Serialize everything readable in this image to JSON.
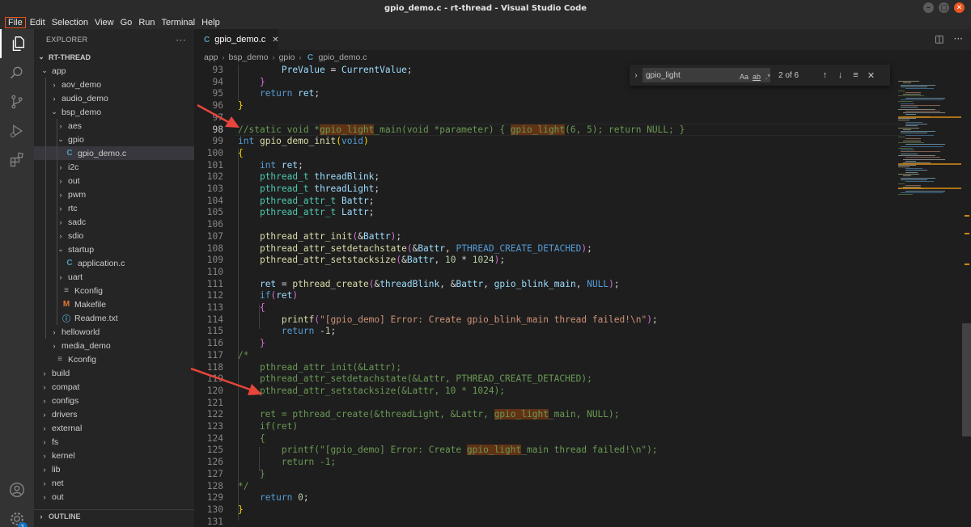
{
  "window": {
    "title": "gpio_demo.c - rt-thread - Visual Studio Code"
  },
  "menu": [
    "File",
    "Edit",
    "Selection",
    "View",
    "Go",
    "Run",
    "Terminal",
    "Help"
  ],
  "activity": {
    "account_badge": "1"
  },
  "explorer": {
    "header": "EXPLORER",
    "more": "···",
    "root": "RT-THREAD",
    "outline": "OUTLINE",
    "tree": [
      {
        "label": "app",
        "depth": 1,
        "kind": "folder-open"
      },
      {
        "label": "aov_demo",
        "depth": 2,
        "kind": "folder"
      },
      {
        "label": "audio_demo",
        "depth": 2,
        "kind": "folder"
      },
      {
        "label": "bsp_demo",
        "depth": 2,
        "kind": "folder-open"
      },
      {
        "label": "aes",
        "depth": 3,
        "kind": "folder"
      },
      {
        "label": "gpio",
        "depth": 3,
        "kind": "folder-open"
      },
      {
        "label": "gpio_demo.c",
        "depth": 4,
        "kind": "c",
        "selected": true
      },
      {
        "label": "i2c",
        "depth": 3,
        "kind": "folder"
      },
      {
        "label": "out",
        "depth": 3,
        "kind": "folder"
      },
      {
        "label": "pwm",
        "depth": 3,
        "kind": "folder"
      },
      {
        "label": "rtc",
        "depth": 3,
        "kind": "folder"
      },
      {
        "label": "sadc",
        "depth": 3,
        "kind": "folder"
      },
      {
        "label": "sdio",
        "depth": 3,
        "kind": "folder"
      },
      {
        "label": "startup",
        "depth": 3,
        "kind": "folder-open"
      },
      {
        "label": "application.c",
        "depth": 4,
        "kind": "c"
      },
      {
        "label": "uart",
        "depth": 3,
        "kind": "folder"
      },
      {
        "label": "Kconfig",
        "depth": 3,
        "kind": "list"
      },
      {
        "label": "Makefile",
        "depth": 3,
        "kind": "m"
      },
      {
        "label": "Readme.txt",
        "depth": 3,
        "kind": "info"
      },
      {
        "label": "helloworld",
        "depth": 2,
        "kind": "folder"
      },
      {
        "label": "media_demo",
        "depth": 2,
        "kind": "folder"
      },
      {
        "label": "Kconfig",
        "depth": 2,
        "kind": "list"
      },
      {
        "label": "build",
        "depth": 1,
        "kind": "folder"
      },
      {
        "label": "compat",
        "depth": 1,
        "kind": "folder"
      },
      {
        "label": "configs",
        "depth": 1,
        "kind": "folder"
      },
      {
        "label": "drivers",
        "depth": 1,
        "kind": "folder"
      },
      {
        "label": "external",
        "depth": 1,
        "kind": "folder"
      },
      {
        "label": "fs",
        "depth": 1,
        "kind": "folder"
      },
      {
        "label": "kernel",
        "depth": 1,
        "kind": "folder"
      },
      {
        "label": "lib",
        "depth": 1,
        "kind": "folder"
      },
      {
        "label": "net",
        "depth": 1,
        "kind": "folder"
      },
      {
        "label": "out",
        "depth": 1,
        "kind": "folder"
      }
    ]
  },
  "editor": {
    "tab": {
      "label": "gpio_demo.c",
      "icon": "C"
    },
    "breadcrumb": [
      "app",
      "bsp_demo",
      "gpio",
      "gpio_demo.c"
    ],
    "find": {
      "query": "gpio_light",
      "case_label": "Aa",
      "word_label": "ab",
      "regex_label": ".*",
      "count": "2 of 6"
    },
    "current_line": 98,
    "lines": [
      {
        "n": 93,
        "html": "        <span class='vr'>PreValue</span> = <span class='vr'>CurrentValue</span>;"
      },
      {
        "n": 94,
        "html": "    <span class='br2'>}</span>"
      },
      {
        "n": 95,
        "html": "    <span class='mc'>return</span> <span class='vr'>ret</span>;"
      },
      {
        "n": 96,
        "html": "<span class='br1'>}</span>"
      },
      {
        "n": 97,
        "html": ""
      },
      {
        "n": 98,
        "html": "<span class='cm'>//static void *<span class='hl'>gpio_light</span>_main(void *parameter) { <span class='hl'>gpio_light</span>(6, 5); return NULL; }</span>"
      },
      {
        "n": 99,
        "html": "<span class='kw'>int</span> <span class='fn'>gpio_demo_init</span><span class='br1'>(</span><span class='kw'>void</span><span class='br1'>)</span>"
      },
      {
        "n": 100,
        "html": "<span class='br1'>{</span>"
      },
      {
        "n": 101,
        "html": "    <span class='kw'>int</span> <span class='vr'>ret</span>;"
      },
      {
        "n": 102,
        "html": "    <span class='ty'>pthread_t</span> <span class='vr'>threadBlink</span>;"
      },
      {
        "n": 103,
        "html": "    <span class='ty'>pthread_t</span> <span class='vr'>threadLight</span>;"
      },
      {
        "n": 104,
        "html": "    <span class='ty'>pthread_attr_t</span> <span class='vr'>Battr</span>;"
      },
      {
        "n": 105,
        "html": "    <span class='ty'>pthread_attr_t</span> <span class='vr'>Lattr</span>;"
      },
      {
        "n": 106,
        "html": ""
      },
      {
        "n": 107,
        "html": "    <span class='fn'>pthread_attr_init</span><span class='br2'>(</span>&amp;<span class='vr'>Battr</span><span class='br2'>)</span>;"
      },
      {
        "n": 108,
        "html": "    <span class='fn'>pthread_attr_setdetachstate</span><span class='br2'>(</span>&amp;<span class='vr'>Battr</span>, <span class='kw'>PTHREAD_CREATE_DETACHED</span><span class='br2'>)</span>;"
      },
      {
        "n": 109,
        "html": "    <span class='fn'>pthread_attr_setstacksize</span><span class='br2'>(</span>&amp;<span class='vr'>Battr</span>, <span class='nm'>10</span> * <span class='nm'>1024</span><span class='br2'>)</span>;"
      },
      {
        "n": 110,
        "html": ""
      },
      {
        "n": 111,
        "html": "    <span class='vr'>ret</span> = <span class='fn'>pthread_create</span><span class='br2'>(</span>&amp;<span class='vr'>threadBlink</span>, &amp;<span class='vr'>Battr</span>, <span class='vr'>gpio_blink_main</span>, <span class='kw'>NULL</span><span class='br2'>)</span>;"
      },
      {
        "n": 112,
        "html": "    <span class='mc'>if</span><span class='br2'>(</span><span class='vr'>ret</span><span class='br2'>)</span>"
      },
      {
        "n": 113,
        "html": "    <span class='br2'>{</span>"
      },
      {
        "n": 114,
        "html": "        <span class='fn'>printf</span><span class='br2'>(</span><span class='st'>\"[gpio_demo] Error: Create gpio_blink_main thread failed!\\n\"</span><span class='br2'>)</span>;"
      },
      {
        "n": 115,
        "html": "        <span class='mc'>return</span> -<span class='nm'>1</span>;"
      },
      {
        "n": 116,
        "html": "    <span class='br2'>}</span>"
      },
      {
        "n": 117,
        "html": "<span class='cm'>/*</span>"
      },
      {
        "n": 118,
        "html": "<span class='cm'>    pthread_attr_init(&amp;Lattr);</span>"
      },
      {
        "n": 119,
        "html": "<span class='cm'>    pthread_attr_setdetachstate(&amp;Lattr, PTHREAD_CREATE_DETACHED);</span>"
      },
      {
        "n": 120,
        "html": "<span class='cm'>    pthread_attr_setstacksize(&amp;Lattr, 10 * 1024);</span>"
      },
      {
        "n": 121,
        "html": ""
      },
      {
        "n": 122,
        "html": "<span class='cm'>    ret = pthread_create(&amp;threadLight, &amp;Lattr, <span class='hl'>gpio_light</span>_main, NULL);</span>"
      },
      {
        "n": 123,
        "html": "<span class='cm'>    if(ret)</span>"
      },
      {
        "n": 124,
        "html": "<span class='cm'>    {</span>"
      },
      {
        "n": 125,
        "html": "<span class='cm'>        printf(\"[gpio_demo] Error: Create <span class='hl'>gpio_light</span>_main thread failed!\\n\");</span>"
      },
      {
        "n": 126,
        "html": "<span class='cm'>        return -1;</span>"
      },
      {
        "n": 127,
        "html": "<span class='cm'>    }</span>"
      },
      {
        "n": 128,
        "html": "<span class='cm'>*/</span>"
      },
      {
        "n": 129,
        "html": "    <span class='mc'>return</span> <span class='nm'>0</span>;"
      },
      {
        "n": 130,
        "html": "<span class='br1'>}</span>"
      },
      {
        "n": 131,
        "html": ""
      }
    ]
  },
  "colors": {
    "accent": "#e95420",
    "highlight": "#613214",
    "comment": "#6a9955",
    "arrow": "#e8453c"
  }
}
